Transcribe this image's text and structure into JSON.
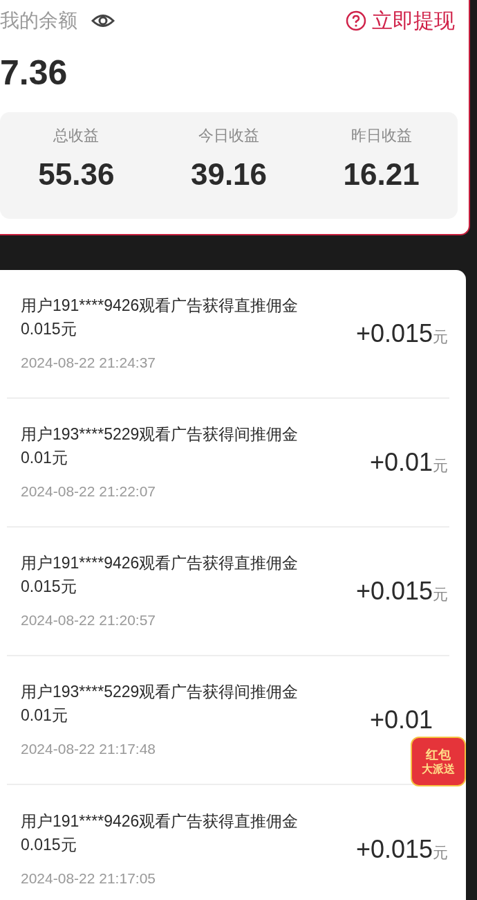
{
  "balance": {
    "label": "我的余额",
    "amount": "7.36",
    "withdraw": "立即提现"
  },
  "stats": [
    {
      "label": "总收益",
      "value": "55.36"
    },
    {
      "label": "今日收益",
      "value": "39.16"
    },
    {
      "label": "昨日收益",
      "value": "16.21"
    }
  ],
  "records": [
    {
      "title": "用户191****9426观看广告获得直推佣金0.015元",
      "time": "2024-08-22 21:24:37",
      "amount": "+0.015",
      "unit": "元"
    },
    {
      "title": "用户193****5229观看广告获得间推佣金0.01元",
      "time": "2024-08-22 21:22:07",
      "amount": "+0.01",
      "unit": "元"
    },
    {
      "title": "用户191****9426观看广告获得直推佣金0.015元",
      "time": "2024-08-22 21:20:57",
      "amount": "+0.015",
      "unit": "元"
    },
    {
      "title": "用户193****5229观看广告获得间推佣金0.01元",
      "time": "2024-08-22 21:17:48",
      "amount": "+0.01"
    },
    {
      "title": "用户191****9426观看广告获得直推佣金0.015元",
      "time": "2024-08-22 21:17:05",
      "amount": "+0.015",
      "unit": "元"
    }
  ],
  "promo": {
    "line_1": "红包",
    "line_2": "大派送"
  }
}
